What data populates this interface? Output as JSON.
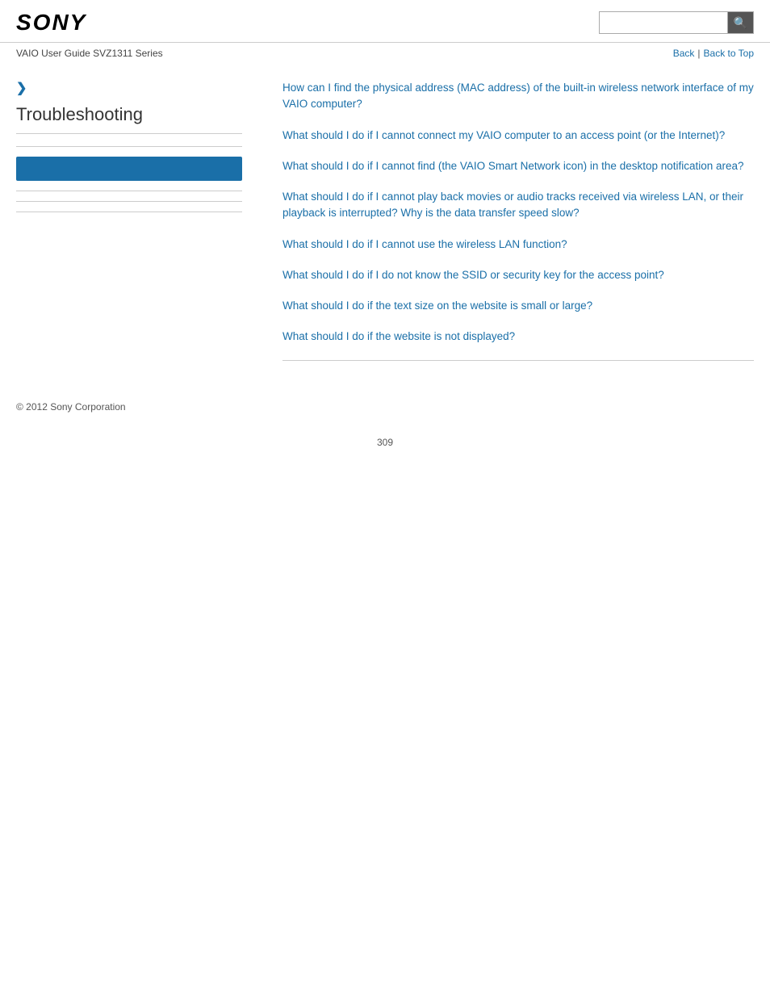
{
  "header": {
    "logo": "SONY",
    "search_placeholder": "",
    "search_icon": "🔍"
  },
  "nav": {
    "guide_title": "VAIO User Guide SVZ1311 Series",
    "back_label": "Back",
    "separator": "|",
    "back_to_top_label": "Back to Top"
  },
  "sidebar": {
    "chevron": "❯",
    "section_title": "Troubleshooting"
  },
  "content": {
    "links": [
      "How can I find the physical address (MAC address) of the built-in wireless network interface of my VAIO computer?",
      "What should I do if I cannot connect my VAIO computer to an access point (or the Internet)?",
      "What should I do if I cannot find (the VAIO Smart Network icon) in the desktop notification area?",
      "What should I do if I cannot play back movies or audio tracks received via wireless LAN, or their playback is interrupted? Why is the data transfer speed slow?",
      "What should I do if I cannot use the wireless LAN function?",
      "What should I do if I do not know the SSID or security key for the access point?",
      "What should I do if the text size on the website is small or large?",
      "What should I do if the website is not displayed?"
    ]
  },
  "footer": {
    "copyright": "© 2012 Sony Corporation"
  },
  "page_number": "309"
}
